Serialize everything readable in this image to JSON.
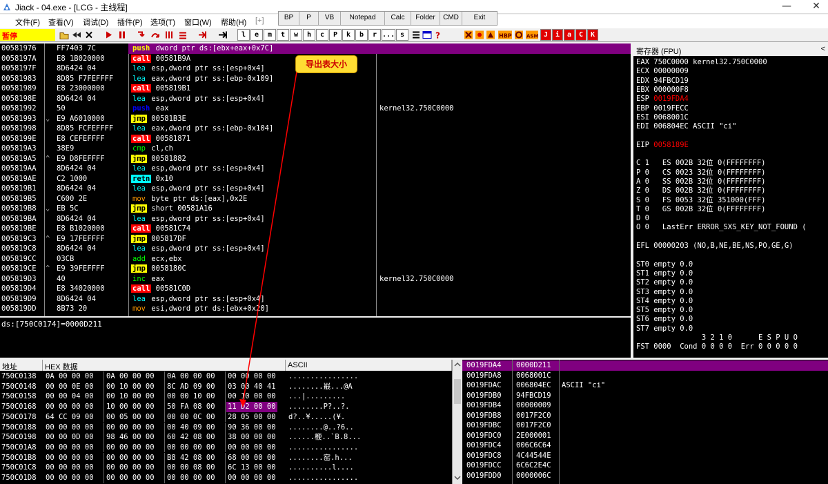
{
  "window": {
    "title": "Jiack  - 04.exe - [LCG - 主线程]",
    "minimize": "—",
    "close": "✕"
  },
  "menu": [
    "文件(F)",
    "查看(V)",
    "调试(D)",
    "插件(P)",
    "选项(T)",
    "窗口(W)",
    "帮助(H)",
    "[+]"
  ],
  "plugin_bar": [
    "BP",
    "P",
    "VB",
    "Notepad",
    "Calc",
    "Folder",
    "CMD",
    "Exit"
  ],
  "toolbar": {
    "status": "暂停",
    "letters": [
      "l",
      "e",
      "m",
      "t",
      "w",
      "h",
      "c",
      "P",
      "k",
      "b",
      "r",
      "...",
      "s"
    ],
    "brand": [
      "J",
      "i",
      "a",
      "C",
      "K"
    ],
    "colors": {
      "brand_bg": "#e00000",
      "status_bg": "#ffff00"
    }
  },
  "disasm": [
    {
      "addr": "00581976",
      "jmp": "",
      "hex": "FF7403 7C",
      "op": "push",
      "opnd": "dword ptr ds:[ebx+eax+0x7C]",
      "cmt": "",
      "sel": true
    },
    {
      "addr": "0058197A",
      "jmp": "",
      "hex": "E8 1B020000",
      "op": "call",
      "opnd": "00581B9A",
      "cmt": ""
    },
    {
      "addr": "0058197F",
      "jmp": "",
      "hex": "8D6424 04",
      "op": "lea",
      "opnd": "esp,dword ptr ss:[esp+0x4]",
      "cmt": ""
    },
    {
      "addr": "00581983",
      "jmp": "",
      "hex": "8D85 F7FEFFFF",
      "op": "lea",
      "opnd": "eax,dword ptr ss:[ebp-0x109]",
      "cmt": ""
    },
    {
      "addr": "00581989",
      "jmp": "",
      "hex": "E8 23000000",
      "op": "call",
      "opnd": "005819B1",
      "cmt": ""
    },
    {
      "addr": "0058198E",
      "jmp": "",
      "hex": "8D6424 04",
      "op": "lea",
      "opnd": "esp,dword ptr ss:[esp+0x4]",
      "cmt": ""
    },
    {
      "addr": "00581992",
      "jmp": "",
      "hex": "50",
      "op": "push",
      "opnd": "eax",
      "cmt": "kernel32.750C0000"
    },
    {
      "addr": "00581993",
      "jmp": "⌄",
      "hex": "E9 A6010000",
      "op": "jmp",
      "opnd": "00581B3E",
      "cmt": ""
    },
    {
      "addr": "00581998",
      "jmp": "",
      "hex": "8D85 FCFEFFFF",
      "op": "lea",
      "opnd": "eax,dword ptr ss:[ebp-0x104]",
      "cmt": ""
    },
    {
      "addr": "0058199E",
      "jmp": "",
      "hex": "E8 CEFEFFFF",
      "op": "call",
      "opnd": "00581871",
      "cmt": ""
    },
    {
      "addr": "005819A3",
      "jmp": "",
      "hex": "38E9",
      "op": "cmp",
      "opnd": "cl,ch",
      "cmt": ""
    },
    {
      "addr": "005819A5",
      "jmp": "^",
      "hex": "E9 D8FEFFFF",
      "op": "jmp",
      "opnd": "00581882",
      "cmt": ""
    },
    {
      "addr": "005819AA",
      "jmp": "",
      "hex": "8D6424 04",
      "op": "lea",
      "opnd": "esp,dword ptr ss:[esp+0x4]",
      "cmt": ""
    },
    {
      "addr": "005819AE",
      "jmp": "",
      "hex": "C2 1000",
      "op": "retn",
      "opnd": "0x10",
      "cmt": ""
    },
    {
      "addr": "005819B1",
      "jmp": "",
      "hex": "8D6424 04",
      "op": "lea",
      "opnd": "esp,dword ptr ss:[esp+0x4]",
      "cmt": ""
    },
    {
      "addr": "005819B5",
      "jmp": "",
      "hex": "C600 2E",
      "op": "mov",
      "opnd": "byte ptr ds:[eax],0x2E",
      "cmt": ""
    },
    {
      "addr": "005819B8",
      "jmp": "⌄",
      "hex": "EB 5C",
      "op": "jmp",
      "opnd": "short 00581A16",
      "cmt": ""
    },
    {
      "addr": "005819BA",
      "jmp": "",
      "hex": "8D6424 04",
      "op": "lea",
      "opnd": "esp,dword ptr ss:[esp+0x4]",
      "cmt": ""
    },
    {
      "addr": "005819BE",
      "jmp": "",
      "hex": "E8 B1020000",
      "op": "call",
      "opnd": "00581C74",
      "cmt": ""
    },
    {
      "addr": "005819C3",
      "jmp": "^",
      "hex": "E9 17FEFFFF",
      "op": "jmp",
      "opnd": "005817DF",
      "cmt": ""
    },
    {
      "addr": "005819C8",
      "jmp": "",
      "hex": "8D6424 04",
      "op": "lea",
      "opnd": "esp,dword ptr ss:[esp+0x4]",
      "cmt": ""
    },
    {
      "addr": "005819CC",
      "jmp": "",
      "hex": "03CB",
      "op": "add",
      "opnd": "ecx,ebx",
      "cmt": ""
    },
    {
      "addr": "005819CE",
      "jmp": "^",
      "hex": "E9 39FEFFFF",
      "op": "jmp",
      "opnd": "0058180C",
      "cmt": ""
    },
    {
      "addr": "005819D3",
      "jmp": "",
      "hex": "40",
      "op": "inc",
      "opnd": "eax",
      "cmt": "kernel32.750C0000"
    },
    {
      "addr": "005819D4",
      "jmp": "",
      "hex": "E8 34020000",
      "op": "call",
      "opnd": "00581C0D",
      "cmt": ""
    },
    {
      "addr": "005819D9",
      "jmp": "",
      "hex": "8D6424 04",
      "op": "lea",
      "opnd": "esp,dword ptr ss:[esp+0x4]",
      "cmt": ""
    },
    {
      "addr": "005819DD",
      "jmp": "",
      "hex": "8B73 20",
      "op": "mov",
      "opnd": "esi,dword ptr ds:[ebx+0x20]",
      "cmt": ""
    }
  ],
  "info_line": "ds:[750C0174]=0000D211",
  "registers": {
    "header": "寄存器 (FPU)",
    "collapse": "<",
    "lines": [
      {
        "t": "EAX 750C0000 kernel32.750C0000"
      },
      {
        "t": "ECX 00000009"
      },
      {
        "t": "EDX 94FBCD19"
      },
      {
        "t": "EBX 000000F8"
      },
      {
        "t": "ESP 0019FDA4",
        "red": true
      },
      {
        "t": "EBP 0019FECC"
      },
      {
        "t": "ESI 0068001C"
      },
      {
        "t": "EDI 006804EC ASCII \"ci\""
      },
      {
        "t": ""
      },
      {
        "t": "EIP 0058189E",
        "red": true
      },
      {
        "t": ""
      },
      {
        "t": "C 1   ES 002B 32位 0(FFFFFFFF)"
      },
      {
        "t": "P 0   CS 0023 32位 0(FFFFFFFF)"
      },
      {
        "t": "A 0   SS 002B 32位 0(FFFFFFFF)"
      },
      {
        "t": "Z 0   DS 002B 32位 0(FFFFFFFF)"
      },
      {
        "t": "S 0   FS 0053 32位 351000(FFF)"
      },
      {
        "t": "T 0   GS 002B 32位 0(FFFFFFFF)"
      },
      {
        "t": "D 0"
      },
      {
        "t": "O 0   LastErr ERROR_SXS_KEY_NOT_FOUND ("
      },
      {
        "t": ""
      },
      {
        "t": "EFL 00000203 (NO,B,NE,BE,NS,PO,GE,G)"
      },
      {
        "t": ""
      },
      {
        "t": "ST0 empty 0.0"
      },
      {
        "t": "ST1 empty 0.0"
      },
      {
        "t": "ST2 empty 0.0"
      },
      {
        "t": "ST3 empty 0.0"
      },
      {
        "t": "ST4 empty 0.0"
      },
      {
        "t": "ST5 empty 0.0"
      },
      {
        "t": "ST6 empty 0.0"
      },
      {
        "t": "ST7 empty 0.0"
      },
      {
        "t": "               3 2 1 0      E S P U O"
      },
      {
        "t": "FST 0000  Cond 0 0 0 0  Err 0 0 0 0 0"
      }
    ]
  },
  "dump": {
    "headers": [
      "地址",
      "HEX 数据",
      "ASCII"
    ],
    "rows": [
      {
        "a": "750C0138",
        "g": [
          "0A 00 00 00",
          "0A 00 00 00",
          "0A 00 00 00",
          "00 00 00 00"
        ],
        "s": "................"
      },
      {
        "a": "750C0148",
        "g": [
          "00 00 0E 00",
          "00 10 00 00",
          "8C AD 09 00",
          "03 00 40 41"
        ],
        "s": "........嶯...@A"
      },
      {
        "a": "750C0158",
        "g": [
          "00 00 04 00",
          "00 10 00 00",
          "00 00 10 00",
          "00 10 00 00"
        ],
        "s": "...|........."
      },
      {
        "a": "750C0168",
        "g": [
          "00 00 00 00",
          "10 00 00 00",
          "50 FA 08 00",
          "11 D2 00 00"
        ],
        "s": "........P?..?.",
        "hl": 3
      },
      {
        "a": "750C0178",
        "g": [
          "64 CC 09 00",
          "00 05 00 00",
          "00 00 0C 00",
          "28 05 00 00"
        ],
        "s": "d?..¥.....(¥."
      },
      {
        "a": "750C0188",
        "g": [
          "00 00 00 00",
          "00 00 00 00",
          "00 40 09 00",
          "90 36 00 00"
        ],
        "s": "........@..?6.."
      },
      {
        "a": "750C0198",
        "g": [
          "00 00 0D 00",
          "98 46 00 00",
          "60 42 08 00",
          "38 00 00 00"
        ],
        "s": "......楩..`B.8..."
      },
      {
        "a": "750C01A8",
        "g": [
          "00 00 00 00",
          "00 00 00 00",
          "00 00 00 00",
          "00 00 00 00"
        ],
        "s": "................"
      },
      {
        "a": "750C01B8",
        "g": [
          "00 00 00 00",
          "00 00 00 00",
          "B8 42 08 00",
          "68 00 00 00"
        ],
        "s": "........窑.h..."
      },
      {
        "a": "750C01C8",
        "g": [
          "00 00 00 00",
          "00 00 00 00",
          "00 00 08 00",
          "6C 13 00 00"
        ],
        "s": "..........l...."
      },
      {
        "a": "750C01D8",
        "g": [
          "00 00 00 00",
          "00 00 00 00",
          "00 00 00 00",
          "00 00 00 00"
        ],
        "s": "................"
      }
    ]
  },
  "stack": [
    {
      "a": "0019FDA4",
      "v": "0000D211",
      "c": "",
      "sel": true
    },
    {
      "a": "0019FDA8",
      "v": "0068001C",
      "c": ""
    },
    {
      "a": "0019FDAC",
      "v": "006804EC",
      "c": "ASCII \"ci\""
    },
    {
      "a": "0019FDB0",
      "v": "94FBCD19",
      "c": ""
    },
    {
      "a": "0019FDB4",
      "v": "00000009",
      "c": ""
    },
    {
      "a": "0019FDB8",
      "v": "0017F2C0",
      "c": ""
    },
    {
      "a": "0019FDBC",
      "v": "0017F2C0",
      "c": ""
    },
    {
      "a": "0019FDC0",
      "v": "2E000001",
      "c": ""
    },
    {
      "a": "0019FDC4",
      "v": "006C6C64",
      "c": ""
    },
    {
      "a": "0019FDC8",
      "v": "4C44544E",
      "c": ""
    },
    {
      "a": "0019FDCC",
      "v": "6C6C2E4C",
      "c": ""
    },
    {
      "a": "0019FDD0",
      "v": "0000006C",
      "c": ""
    }
  ],
  "callout": {
    "text": "导出表大小",
    "color": "#ff0000"
  }
}
